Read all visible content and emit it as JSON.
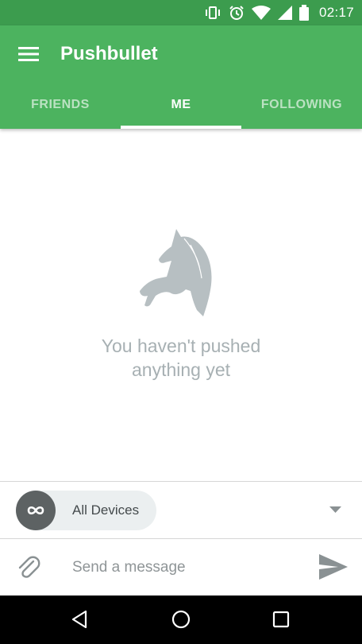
{
  "status_bar": {
    "time": "02:17",
    "icons": [
      "vibrate-icon",
      "alarm-icon",
      "wifi-icon",
      "cell-signal-icon",
      "battery-icon"
    ]
  },
  "app_bar": {
    "title": "Pushbullet",
    "color": "#4cb35f",
    "tabs": [
      {
        "label": "FRIENDS",
        "active": false
      },
      {
        "label": "ME",
        "active": true
      },
      {
        "label": "FOLLOWING",
        "active": false
      }
    ]
  },
  "empty_state": {
    "icon": "unicorn-icon",
    "line1": "You haven't pushed",
    "line2": "anything yet"
  },
  "device_selector": {
    "selected": "All Devices",
    "icon": "infinity-icon"
  },
  "composer": {
    "placeholder": "Send a message"
  },
  "nav_bar": {
    "buttons": [
      "back-icon",
      "home-icon",
      "recents-icon"
    ]
  }
}
